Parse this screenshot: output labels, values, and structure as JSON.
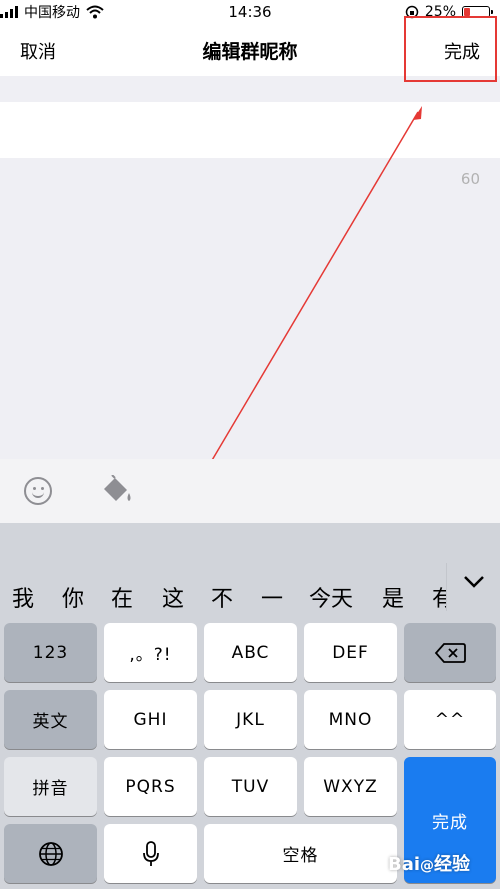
{
  "status_bar": {
    "carrier": "中国移动",
    "time": "14:36",
    "battery": "25%",
    "battery_level": 0.25
  },
  "nav": {
    "cancel": "取消",
    "title": "编辑群昵称",
    "done": "完成"
  },
  "name_field": {
    "value": "",
    "placeholder": ""
  },
  "char_counter": "60",
  "toolbar": {
    "emoji_icon": "smiley-icon",
    "paint_icon": "paint-bucket-icon"
  },
  "candidates": [
    "我",
    "你",
    "在",
    "这",
    "不",
    "一",
    "今天",
    "是",
    "有"
  ],
  "keyboard": {
    "rows": [
      [
        "123",
        ",。?!",
        "ABC",
        "DEF",
        "delete"
      ],
      [
        "英文",
        "GHI",
        "JKL",
        "MNO",
        "^^"
      ],
      [
        "拼音",
        "PQRS",
        "TUV",
        "WXYZ"
      ],
      [
        "globe",
        "mic",
        "空格"
      ]
    ],
    "done": "完成"
  },
  "colors": {
    "accent": "#1a7cf0",
    "highlight": "#e53935"
  }
}
